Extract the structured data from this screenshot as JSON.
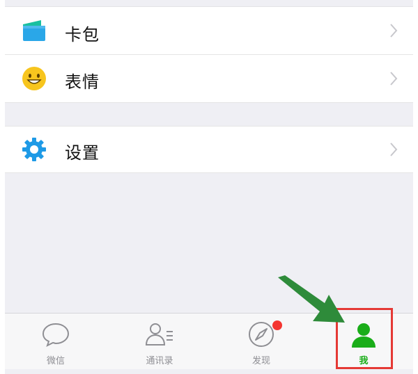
{
  "menu": {
    "items": [
      {
        "label": "卡包",
        "icon": "card-wallet-icon"
      },
      {
        "label": "表情",
        "icon": "smiley-face-icon"
      },
      {
        "label": "设置",
        "icon": "settings-gear-icon"
      }
    ]
  },
  "tabbar": {
    "tabs": [
      {
        "label": "微信",
        "icon": "chat-bubble-icon",
        "active": false
      },
      {
        "label": "通讯录",
        "icon": "contacts-icon",
        "active": false
      },
      {
        "label": "发现",
        "icon": "compass-icon",
        "active": false,
        "badge": true
      },
      {
        "label": "我",
        "icon": "person-icon",
        "active": true
      }
    ]
  },
  "colors": {
    "accent_green": "#1aad19",
    "annotation_red": "#e53935",
    "annotation_arrow": "#2e8b3a",
    "wallet_blue": "#2aa7e8",
    "smiley_yellow": "#f7c51e",
    "settings_blue": "#1e9ae6",
    "badge_red": "#f43530",
    "background": "#efeff4"
  }
}
